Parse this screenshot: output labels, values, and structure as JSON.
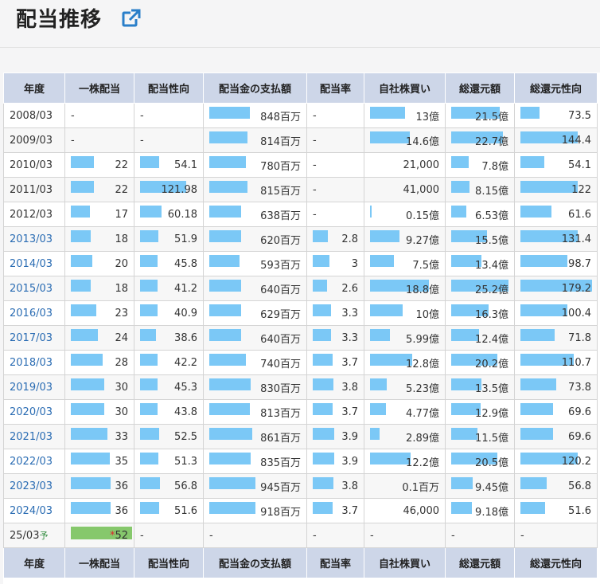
{
  "header": {
    "title": "配当推移",
    "link_icon": "external-link-icon"
  },
  "table": {
    "columns": [
      "年度",
      "一株配当",
      "配当性向",
      "配当金の支払額",
      "配当率",
      "自社株買い",
      "総還元額",
      "総還元性向"
    ],
    "rows": [
      {
        "year": "2008/03",
        "link": false,
        "cells": [
          [
            "-",
            0
          ],
          [
            "-",
            0
          ],
          [
            "848百万",
            0.44
          ],
          [
            "-",
            0
          ],
          [
            "13億",
            0.52
          ],
          [
            "21.5億",
            0.85
          ],
          [
            "73.5",
            0.27
          ]
        ]
      },
      {
        "year": "2009/03",
        "link": false,
        "cells": [
          [
            "-",
            0
          ],
          [
            "-",
            0
          ],
          [
            "814百万",
            0.42
          ],
          [
            "-",
            0
          ],
          [
            "14.6億",
            0.59
          ],
          [
            "22.7億",
            0.9
          ],
          [
            "144.4",
            0.8
          ]
        ]
      },
      {
        "year": "2010/03",
        "link": false,
        "cells": [
          [
            "22",
            0.4
          ],
          [
            "54.1",
            0.33
          ],
          [
            "780百万",
            0.4
          ],
          [
            "-",
            0
          ],
          [
            "21,000",
            0
          ],
          [
            "7.8億",
            0.31
          ],
          [
            "54.1",
            0.33
          ]
        ]
      },
      {
        "year": "2011/03",
        "link": false,
        "cells": [
          [
            "22",
            0.4
          ],
          [
            "121.98",
            0.8
          ],
          [
            "815百万",
            0.42
          ],
          [
            "-",
            0
          ],
          [
            "41,000",
            0
          ],
          [
            "8.15億",
            0.32
          ],
          [
            "122",
            0.8
          ]
        ]
      },
      {
        "year": "2012/03",
        "link": false,
        "cells": [
          [
            "17",
            0.33
          ],
          [
            "60.18",
            0.38
          ],
          [
            "638百万",
            0.35
          ],
          [
            "-",
            0
          ],
          [
            "0.15億",
            0.02
          ],
          [
            "6.53億",
            0.26
          ],
          [
            "61.6",
            0.43
          ]
        ]
      },
      {
        "year": "2013/03",
        "link": true,
        "cells": [
          [
            "18",
            0.35
          ],
          [
            "51.9",
            0.32
          ],
          [
            "620百万",
            0.35
          ],
          [
            "2.8",
            0.35
          ],
          [
            "9.27億",
            0.44
          ],
          [
            "15.5億",
            0.62
          ],
          [
            "131.4",
            0.8
          ]
        ]
      },
      {
        "year": "2014/03",
        "link": true,
        "cells": [
          [
            "20",
            0.38
          ],
          [
            "45.8",
            0.3
          ],
          [
            "593百万",
            0.33
          ],
          [
            "3",
            0.38
          ],
          [
            "7.5億",
            0.35
          ],
          [
            "13.4億",
            0.53
          ],
          [
            "98.7",
            0.66
          ]
        ]
      },
      {
        "year": "2015/03",
        "link": true,
        "cells": [
          [
            "18",
            0.35
          ],
          [
            "41.2",
            0.3
          ],
          [
            "640百万",
            0.35
          ],
          [
            "2.6",
            0.33
          ],
          [
            "18.8億",
            0.87
          ],
          [
            "25.2億",
            1.0
          ],
          [
            "179.2",
            1.0
          ]
        ]
      },
      {
        "year": "2016/03",
        "link": true,
        "cells": [
          [
            "23",
            0.45
          ],
          [
            "40.9",
            0.3
          ],
          [
            "629百万",
            0.35
          ],
          [
            "3.3",
            0.41
          ],
          [
            "10億",
            0.48
          ],
          [
            "16.3億",
            0.65
          ],
          [
            "100.4",
            0.65
          ]
        ]
      },
      {
        "year": "2017/03",
        "link": true,
        "cells": [
          [
            "24",
            0.47
          ],
          [
            "38.6",
            0.28
          ],
          [
            "640百万",
            0.35
          ],
          [
            "3.3",
            0.41
          ],
          [
            "5.99億",
            0.29
          ],
          [
            "12.4億",
            0.49
          ],
          [
            "71.8",
            0.48
          ]
        ]
      },
      {
        "year": "2018/03",
        "link": true,
        "cells": [
          [
            "28",
            0.55
          ],
          [
            "42.2",
            0.3
          ],
          [
            "740百万",
            0.4
          ],
          [
            "3.7",
            0.46
          ],
          [
            "12.8億",
            0.62
          ],
          [
            "20.2億",
            0.8
          ],
          [
            "110.7",
            0.74
          ]
        ]
      },
      {
        "year": "2019/03",
        "link": true,
        "cells": [
          [
            "30",
            0.58
          ],
          [
            "45.3",
            0.3
          ],
          [
            "830百万",
            0.45
          ],
          [
            "3.8",
            0.48
          ],
          [
            "5.23億",
            0.25
          ],
          [
            "13.5億",
            0.53
          ],
          [
            "73.8",
            0.5
          ]
        ]
      },
      {
        "year": "2020/03",
        "link": true,
        "cells": [
          [
            "30",
            0.58
          ],
          [
            "43.8",
            0.3
          ],
          [
            "813百万",
            0.44
          ],
          [
            "3.7",
            0.46
          ],
          [
            "4.77億",
            0.23
          ],
          [
            "12.9億",
            0.51
          ],
          [
            "69.6",
            0.46
          ]
        ]
      },
      {
        "year": "2021/03",
        "link": true,
        "cells": [
          [
            "33",
            0.64
          ],
          [
            "52.5",
            0.33
          ],
          [
            "861百万",
            0.47
          ],
          [
            "3.9",
            0.49
          ],
          [
            "2.89億",
            0.14
          ],
          [
            "11.5億",
            0.46
          ],
          [
            "69.6",
            0.46
          ]
        ]
      },
      {
        "year": "2022/03",
        "link": true,
        "cells": [
          [
            "35",
            0.68
          ],
          [
            "51.3",
            0.32
          ],
          [
            "835百万",
            0.45
          ],
          [
            "3.9",
            0.49
          ],
          [
            "12.2億",
            0.6
          ],
          [
            "20.5億",
            0.81
          ],
          [
            "120.2",
            0.8
          ]
        ]
      },
      {
        "year": "2023/03",
        "link": true,
        "cells": [
          [
            "36",
            0.7
          ],
          [
            "56.8",
            0.35
          ],
          [
            "945百万",
            0.5
          ],
          [
            "3.8",
            0.48
          ],
          [
            "0.1百万",
            0
          ],
          [
            "9.45億",
            0.37
          ],
          [
            "56.8",
            0.37
          ]
        ]
      },
      {
        "year": "2024/03",
        "link": true,
        "cells": [
          [
            "36",
            0.7
          ],
          [
            "51.6",
            0.33
          ],
          [
            "918百万",
            0.5
          ],
          [
            "3.7",
            0.46
          ],
          [
            "46,000",
            0
          ],
          [
            "9.18億",
            0.36
          ],
          [
            "51.6",
            0.34
          ]
        ]
      }
    ],
    "forecast_row": {
      "year": "25/03",
      "year_suffix": "予",
      "dividend": "52",
      "dividend_level": 1.0,
      "star": "*",
      "rest": [
        "-",
        "-",
        "-",
        "-",
        "-",
        "-"
      ]
    }
  },
  "colors": {
    "bar": "#7bc8f6",
    "forecast_bar": "#86c86c",
    "header_bg": "#cdd6e8",
    "link": "#2a6cb3"
  }
}
